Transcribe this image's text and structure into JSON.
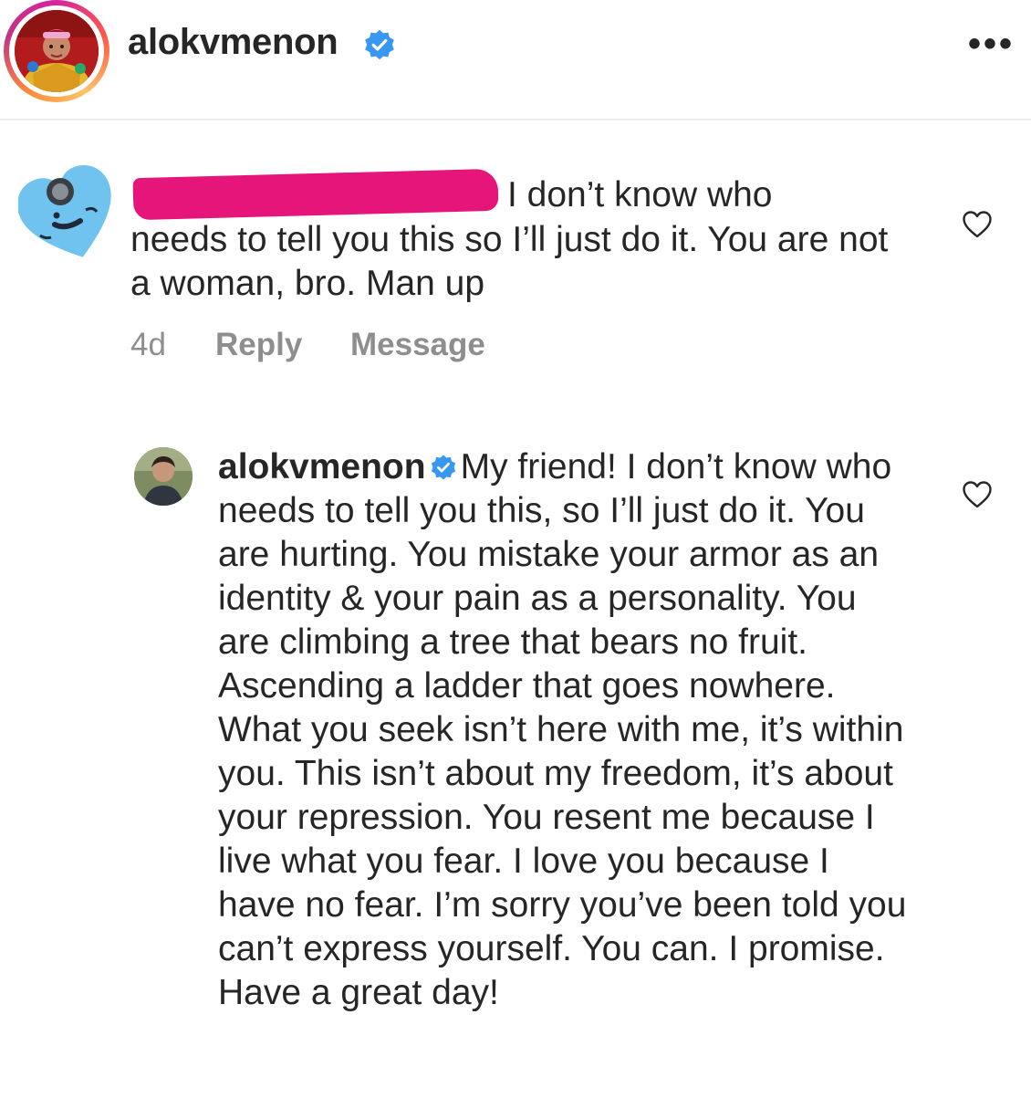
{
  "post": {
    "username": "alokvmenon",
    "verified": true,
    "more_icon": "more-horizontal-icon"
  },
  "comment": {
    "author_redacted": true,
    "text_line1": "I don’t know who",
    "text_rest": "needs to tell you this so I’ll just do it. You are not a woman, bro. Man up",
    "time": "4d",
    "reply_label": "Reply",
    "message_label": "Message",
    "like_icon": "heart-outline-icon"
  },
  "reply": {
    "username": "alokvmenon",
    "verified": true,
    "text": "My friend! I don’t know who needs to tell you this, so I’ll just do it. You are hurting. You mistake your armor as an identity & your pain as a personality. You are climbing a tree that bears no fruit. Ascending a ladder that goes nowhere. What you seek isn’t here with me, it’s within you. This isn’t about my freedom, it’s about your repression. You resent me because I live what you fear. I love you because I have no fear. I’m sorry you’ve been told you can’t express yourself. You can. I promise. Have a great day!",
    "like_icon": "heart-outline-icon"
  },
  "colors": {
    "verified_blue": "#3897f0",
    "redaction_pink": "#e6157a",
    "meta_gray": "#8e8e8e",
    "heart_avatar_blue": "#6fc3ee"
  }
}
